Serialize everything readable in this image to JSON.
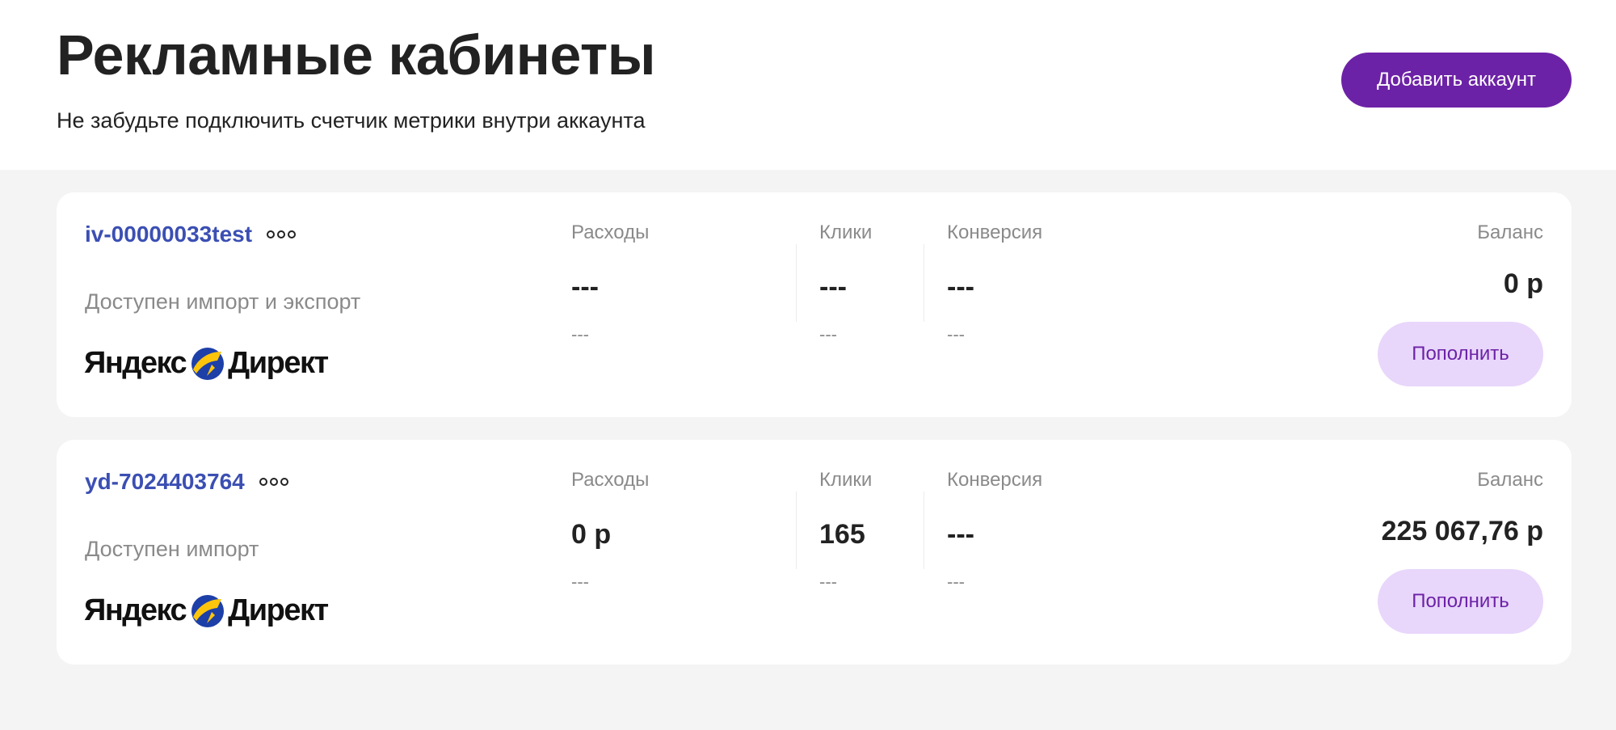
{
  "header": {
    "title": "Рекламные кабинеты",
    "subtitle": "Не забудьте подключить счетчик метрики внутри аккаунта",
    "add_button_label": "Добавить аккаунт"
  },
  "accounts": [
    {
      "name": "iv-00000033test",
      "status": "Доступен импорт и экспорт",
      "logo": {
        "left": "Яндекс",
        "right": "Директ"
      },
      "spend": {
        "label": "Расходы",
        "value": "---",
        "sub": "---"
      },
      "clicks": {
        "label": "Клики",
        "value": "---",
        "sub": "---"
      },
      "conversion": {
        "label": "Конверсия",
        "value": "---",
        "sub": "---"
      },
      "balance": {
        "label": "Баланс",
        "value": "0 р"
      },
      "topup_label": "Пополнить"
    },
    {
      "name": "yd-7024403764",
      "status": "Доступен импорт",
      "logo": {
        "left": "Яндекс",
        "right": "Директ"
      },
      "spend": {
        "label": "Расходы",
        "value": "0 р",
        "sub": "---"
      },
      "clicks": {
        "label": "Клики",
        "value": "165",
        "sub": "---"
      },
      "conversion": {
        "label": "Конверсия",
        "value": "---",
        "sub": "---"
      },
      "balance": {
        "label": "Баланс",
        "value": "225 067,76 р"
      },
      "topup_label": "Пополнить"
    }
  ],
  "icons": {
    "more": "more-dots-icon",
    "logo_mark": "yandex-direct-arrow-icon"
  },
  "colors": {
    "accent": "#6c22a6",
    "accent_light": "#e8d6fb",
    "link": "#3b4fb3",
    "logo_yellow": "#fcc50c",
    "logo_blue": "#1d3fa8"
  }
}
